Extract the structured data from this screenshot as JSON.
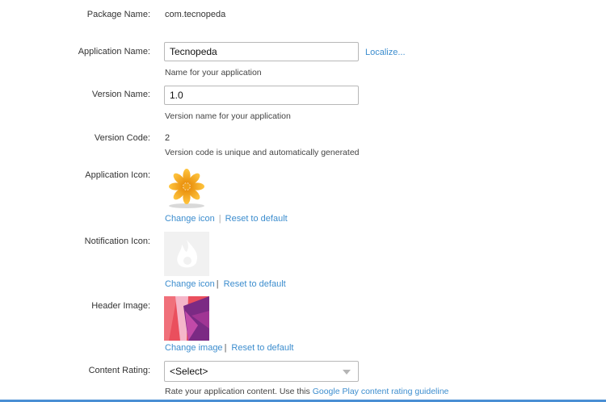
{
  "package": {
    "label": "Package Name:",
    "value": "com.tecnopeda"
  },
  "app_name": {
    "label": "Application Name:",
    "value": "Tecnopeda",
    "localize": "Localize...",
    "hint": "Name for your application"
  },
  "version_name": {
    "label": "Version Name:",
    "value": "1.0",
    "hint": "Version name for your application"
  },
  "version_code": {
    "label": "Version Code:",
    "value": "2",
    "hint": "Version code is unique and automatically generated"
  },
  "app_icon": {
    "label": "Application Icon:",
    "change": "Change icon",
    "reset": "Reset to default"
  },
  "notif_icon": {
    "label": "Notification Icon:",
    "change": "Change icon",
    "reset": "Reset to default"
  },
  "header_image": {
    "label": "Header Image:",
    "change": "Change image",
    "reset": "Reset to default"
  },
  "content_rating": {
    "label": "Content Rating:",
    "selected": "<Select>",
    "hint_prefix": "Rate your application content. Use this",
    "hint_link": "Google Play content rating guideline"
  },
  "colors": {
    "link": "#3c8dce",
    "icon_orange": "#f3a21a",
    "header_pink": "#e8505e",
    "header_purple": "#8e2a86"
  }
}
